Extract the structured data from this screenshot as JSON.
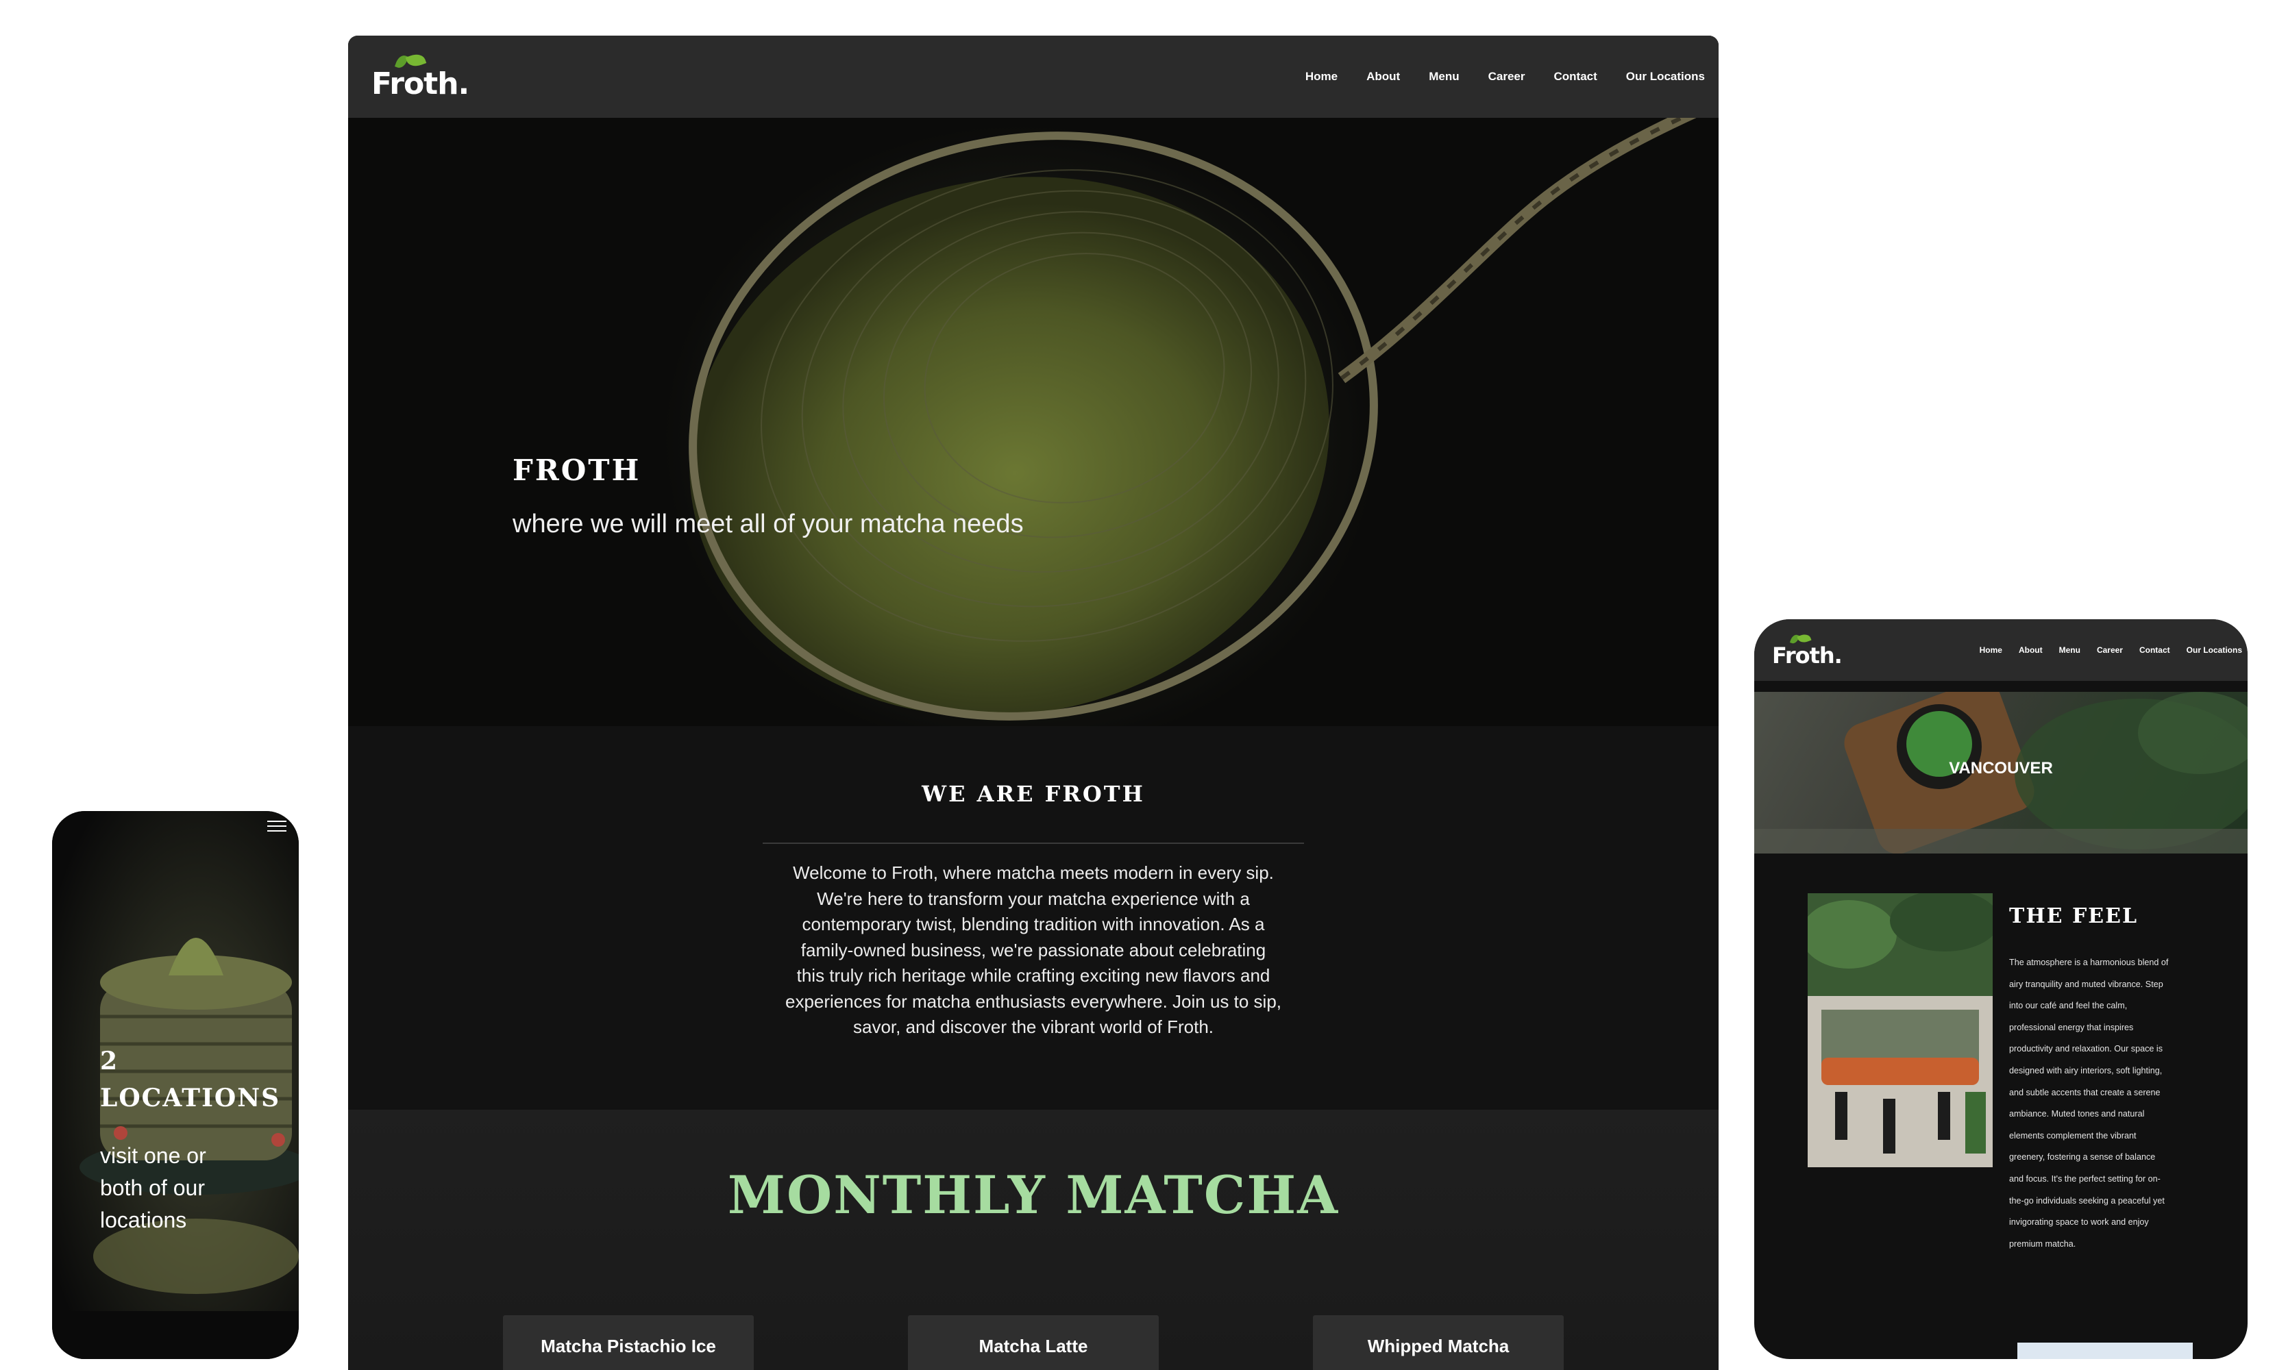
{
  "brand": {
    "logo_text": "Froth."
  },
  "nav": {
    "items": [
      {
        "label": "Home"
      },
      {
        "label": "About"
      },
      {
        "label": "Menu"
      },
      {
        "label": "Career"
      },
      {
        "label": "Contact"
      },
      {
        "label": "Our Locations"
      }
    ]
  },
  "hero": {
    "title": "FROTH",
    "subtitle": "where we will meet all of your matcha needs"
  },
  "about": {
    "title": "WE ARE FROTH",
    "lines": [
      "Welcome to Froth, where matcha meets modern in every sip.",
      "We're here to transform your matcha experience with a",
      "contemporary twist, blending tradition with innovation. As a",
      "family-owned business, we're passionate about celebrating",
      "this truly rich heritage while crafting exciting new flavors and",
      "experiences for matcha enthusiasts everywhere. Join us to sip,",
      "savor, and discover the vibrant world of Froth."
    ]
  },
  "monthly": {
    "title": "MONTHLY MATCHA",
    "cards": [
      {
        "name": "Matcha Pistachio Ice"
      },
      {
        "name": "Matcha Latte"
      },
      {
        "name": "Whipped Matcha"
      }
    ]
  },
  "phone": {
    "locations_title_line1": "2",
    "locations_title_line2": "LOCATIONS",
    "locations_text_lines": [
      "visit one or",
      "both of our",
      "locations"
    ]
  },
  "tablet": {
    "hero_label": "VANCOUVER",
    "feel_title": "THE FEEL",
    "feel_lines": [
      "The atmosphere is a harmonious blend of",
      "airy tranquility and muted vibrance. Step",
      "into our café and feel the calm,",
      "professional energy that inspires",
      "productivity and relaxation. Our space is",
      "designed with airy interiors, soft lighting,",
      "and subtle accents that create a serene",
      "ambiance. Muted tones and natural",
      "elements complement the vibrant",
      "greenery, fostering a sense of balance",
      "and focus. It's the perfect setting for on-",
      "the-go individuals seeking a peaceful yet",
      "invigorating space to work and enjoy",
      "premium matcha."
    ]
  },
  "colors": {
    "nav_bg": "#2b2b2b",
    "page_bg": "#121212",
    "accent_green": "#a6dca0",
    "leaf_green": "#78b833"
  }
}
